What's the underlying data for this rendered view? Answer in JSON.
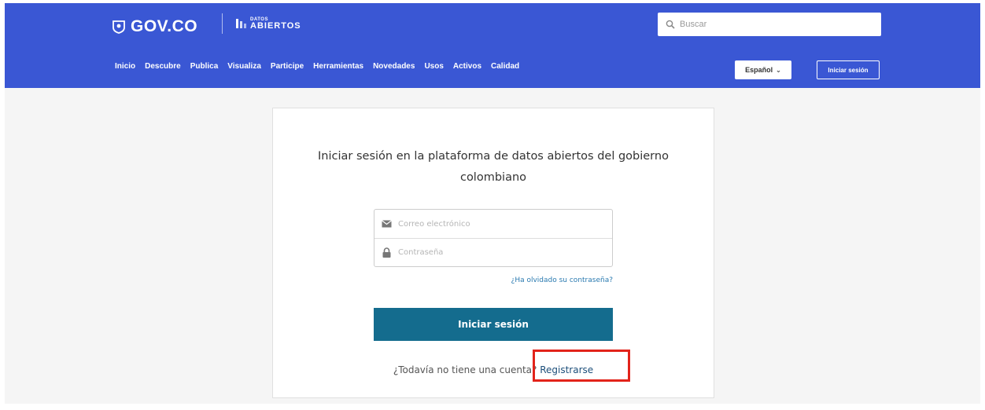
{
  "header": {
    "gov_logo_text": "GOV.CO",
    "datos_logo_small": "DATOS",
    "datos_logo_big": "ABIERTOS",
    "search_placeholder": "Buscar",
    "nav_items": [
      "Inicio",
      "Descubre",
      "Publica",
      "Visualiza",
      "Participe",
      "Herramientas",
      "Novedades",
      "Usos",
      "Activos",
      "Calidad"
    ],
    "language_selected": "Español",
    "login_button": "Iniciar sesión",
    "brand_color": "#3a57d4"
  },
  "login_card": {
    "title": "Iniciar sesión en la plataforma de datos abiertos del gobierno colombiano",
    "email_placeholder": "Correo electrónico",
    "password_placeholder": "Contraseña",
    "forgot_password": "¿Ha olvidado su contraseña?",
    "submit_button": "Iniciar sesión",
    "button_color": "#146c8e",
    "register_prompt": "¿Todavía no tiene una cuenta?",
    "register_link": "Registrarse"
  },
  "annotation": {
    "highlight_color": "#e2231a",
    "highlight_target": "Registrarse"
  }
}
